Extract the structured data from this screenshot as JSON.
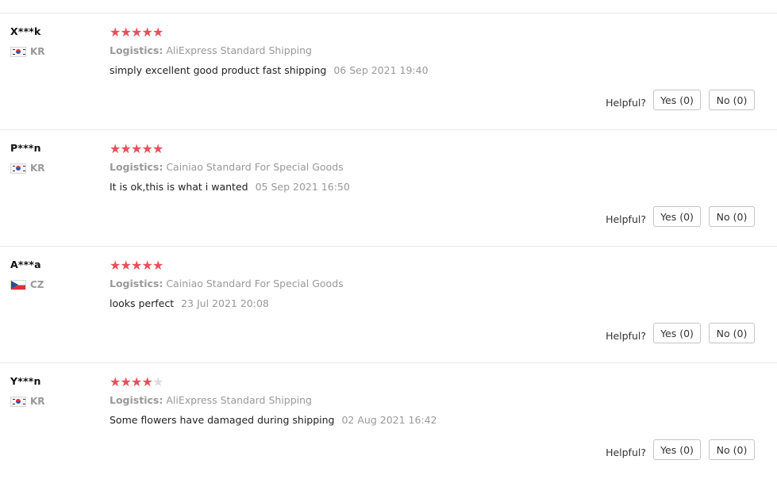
{
  "helpful_label": "Helpful?",
  "logistics_label": "Logistics:",
  "reviews": [
    {
      "user": "X***k",
      "country": "KR",
      "rating": 5,
      "logistics": "AliExpress Standard Shipping",
      "text": "simply excellent good product fast shipping",
      "date": "06 Sep 2021 19:40",
      "yes_label": "Yes (0)",
      "no_label": "No (0)"
    },
    {
      "user": "P***n",
      "country": "KR",
      "rating": 5,
      "logistics": "Cainiao Standard For Special Goods",
      "text": "It is ok,this is what i wanted",
      "date": "05 Sep 2021 16:50",
      "yes_label": "Yes (0)",
      "no_label": "No (0)"
    },
    {
      "user": "A***a",
      "country": "CZ",
      "rating": 5,
      "logistics": "Cainiao Standard For Special Goods",
      "text": "looks perfect",
      "date": "23 Jul 2021 20:08",
      "yes_label": "Yes (0)",
      "no_label": "No (0)"
    },
    {
      "user": "Y***n",
      "country": "KR",
      "rating": 4,
      "logistics": "AliExpress Standard Shipping",
      "text": "Some flowers have damaged during shipping",
      "date": "02 Aug 2021 16:42",
      "yes_label": "Yes (0)",
      "no_label": "No (0)"
    }
  ],
  "colors": {
    "star_on": "#e8505a",
    "star_off": "#dcdcdc",
    "muted_text": "#999999",
    "divider": "#e8e8e8"
  }
}
